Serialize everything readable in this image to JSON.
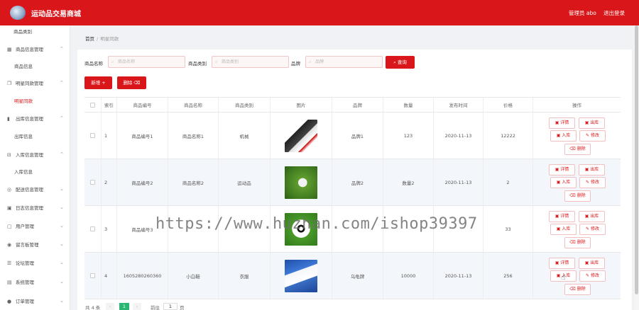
{
  "header": {
    "title": "运动品交易商城",
    "admin": "管理员 abo",
    "logout": "退出登录"
  },
  "sidebar": {
    "items": [
      {
        "label": "商品类别",
        "icon": "",
        "sub": true,
        "top": 0
      },
      {
        "label": "商品信息管理",
        "icon": "grid-icon",
        "arrow": true
      },
      {
        "label": "商品信息",
        "sub": true
      },
      {
        "label": "明星同款管理",
        "icon": "copy-icon",
        "arrow": true
      },
      {
        "label": "明星同款",
        "sub": true,
        "active": true
      },
      {
        "label": "出库信息管理",
        "icon": "bar-chart-icon",
        "arrow": true
      },
      {
        "label": "出库信息",
        "sub": true
      },
      {
        "label": "入库信息管理",
        "icon": "inbox-icon",
        "arrow": true
      },
      {
        "label": "入库信息",
        "sub": true
      },
      {
        "label": "配送信息管理",
        "icon": "globe-icon",
        "arrow": true
      },
      {
        "label": "日志信息管理",
        "icon": "calendar-icon",
        "arrow": true
      },
      {
        "label": "用户管理",
        "icon": "user-icon",
        "arrow": true
      },
      {
        "label": "留言板管理",
        "icon": "compass-icon",
        "arrow": true
      },
      {
        "label": "论坛管理",
        "icon": "list-icon",
        "arrow": true
      },
      {
        "label": "系统管理",
        "icon": "settings-icon",
        "arrow": true
      },
      {
        "label": "订单管理",
        "icon": "location-icon",
        "arrow": true
      }
    ]
  },
  "breadcrumb": {
    "home": "首页",
    "current": "明星同款"
  },
  "filters": [
    {
      "label": "商品名称",
      "placeholder": "商品名称"
    },
    {
      "label": "商品类别",
      "placeholder": "商品类别"
    },
    {
      "label": "品牌",
      "placeholder": "品牌"
    }
  ],
  "buttons": {
    "search": "查询",
    "add": "新增",
    "delete": "删除"
  },
  "table": {
    "headers": [
      "索引",
      "商品编号",
      "商品名称",
      "商品类别",
      "图片",
      "品牌",
      "数量",
      "发布时间",
      "价格",
      "操作"
    ],
    "rows": [
      {
        "index": "1",
        "code": "商品编号1",
        "name": "商品名称1",
        "category": "机械",
        "image": "treadmill-image",
        "brand": "品牌1",
        "qty": "123",
        "date": "2020-11-13",
        "price": "12222"
      },
      {
        "index": "2",
        "code": "商品编号2",
        "name": "商品名称2",
        "category": "运动品",
        "image": "badminton-image",
        "brand": "品牌2",
        "qty": "数量2",
        "date": "2020-11-13",
        "price": "2"
      },
      {
        "index": "3",
        "code": "商品编号3",
        "name": "",
        "category": "",
        "image": "soccer-ball-image",
        "brand": "",
        "qty": "",
        "date": "",
        "price": "33"
      },
      {
        "index": "4",
        "code": "1605280260360",
        "name": "小白鞋",
        "category": "衣服",
        "image": "white-shoe-image",
        "brand": "乌龟牌",
        "qty": "10000",
        "date": "2020-11-13",
        "price": "256"
      }
    ],
    "actions": {
      "detail": "详情",
      "outbound": "出库",
      "inbound": "入库",
      "edit": "修改",
      "delete": "删除"
    }
  },
  "pager": {
    "total": "共 4 条",
    "page": "1",
    "goto": "前往",
    "unit": "页"
  },
  "watermark": "https://www.huzhan.com/ishop39397",
  "colors": {
    "primary": "#d9171a",
    "header_bg": "#d9171a",
    "row_alt": "#f3f6fb"
  }
}
